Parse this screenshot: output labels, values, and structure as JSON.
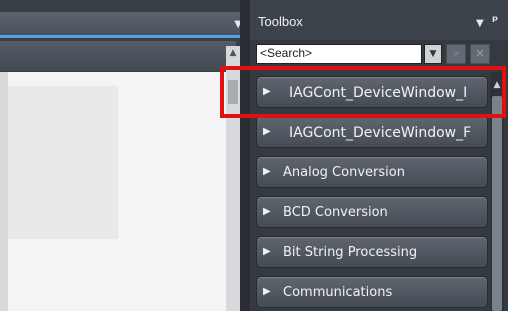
{
  "toolbox": {
    "title": "Toolbox",
    "search_placeholder": "<Search>",
    "categories": [
      {
        "label": "IAGCont_DeviceWindow_I"
      },
      {
        "label": "IAGCont_DeviceWindow_F"
      },
      {
        "label": "Analog Conversion"
      },
      {
        "label": "BCD Conversion"
      },
      {
        "label": "Bit String Processing"
      },
      {
        "label": "Communications"
      }
    ]
  },
  "icons": {
    "expand": "triangle-right-icon",
    "dropdown": "chevron-down-icon",
    "pin": "pin-icon",
    "search": "search-icon",
    "clear": "close-icon"
  },
  "colors": {
    "highlight": "#e01010",
    "accent": "#4fa6e6",
    "panel_bg": "#353a41"
  }
}
